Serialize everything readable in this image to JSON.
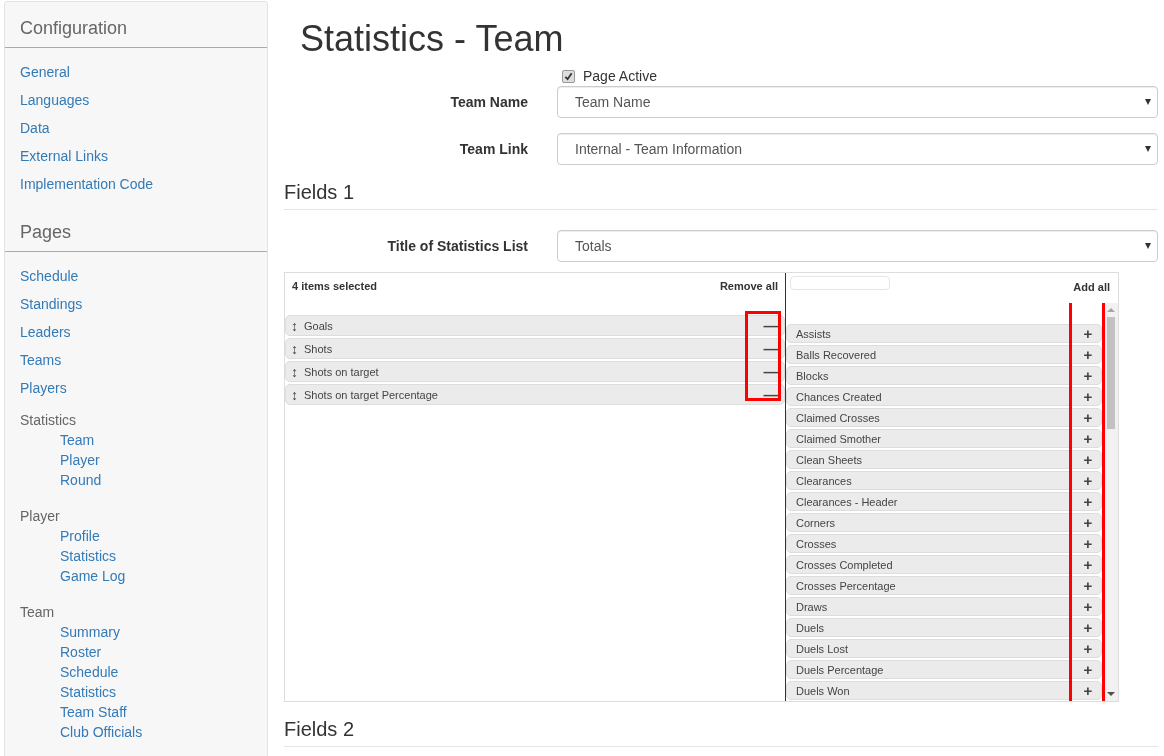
{
  "sidebar": {
    "sections": [
      {
        "title": "Configuration",
        "items": [
          {
            "label": "General"
          },
          {
            "label": "Languages"
          },
          {
            "label": "Data"
          },
          {
            "label": "External Links"
          },
          {
            "label": "Implementation Code"
          }
        ]
      },
      {
        "title": "Pages",
        "items": [
          {
            "label": "Schedule"
          },
          {
            "label": "Standings"
          },
          {
            "label": "Leaders"
          },
          {
            "label": "Teams"
          },
          {
            "label": "Players"
          },
          {
            "label": "Statistics",
            "children": [
              {
                "label": "Team"
              },
              {
                "label": "Player"
              },
              {
                "label": "Round"
              }
            ]
          },
          {
            "label": "Player",
            "children": [
              {
                "label": "Profile"
              },
              {
                "label": "Statistics"
              },
              {
                "label": "Game Log"
              }
            ]
          },
          {
            "label": "Team",
            "children": [
              {
                "label": "Summary"
              },
              {
                "label": "Roster"
              },
              {
                "label": "Schedule"
              },
              {
                "label": "Statistics"
              },
              {
                "label": "Team Staff"
              },
              {
                "label": "Club Officials"
              }
            ]
          }
        ]
      }
    ]
  },
  "page_title": "Statistics - Team",
  "page_active": {
    "label": "Page Active",
    "checked": true
  },
  "fields": [
    {
      "label": "Team Name",
      "value": "Team Name"
    },
    {
      "label": "Team Link",
      "value": "Internal - Team Information"
    }
  ],
  "sections": [
    {
      "title": "Fields 1",
      "list_title": {
        "label": "Title of Statistics List",
        "value": "Totals"
      },
      "selected": {
        "count": "4 items selected",
        "remove_all": "Remove all",
        "remove_icon": "—",
        "drag_icon": "↕",
        "items": [
          "Goals",
          "Shots",
          "Shots on target",
          "Shots on target Percentage"
        ]
      },
      "available": {
        "add_all": "Add all",
        "add_icon": "+",
        "items": [
          "Assists",
          "Balls Recovered",
          "Blocks",
          "Chances Created",
          "Claimed Crosses",
          "Claimed Smother",
          "Clean Sheets",
          "Clearances",
          "Clearances - Header",
          "Corners",
          "Crosses",
          "Crosses Completed",
          "Crosses Percentage",
          "Draws",
          "Duels",
          "Duels Lost",
          "Duels Percentage",
          "Duels Won"
        ]
      }
    },
    {
      "title": "Fields 2"
    }
  ]
}
